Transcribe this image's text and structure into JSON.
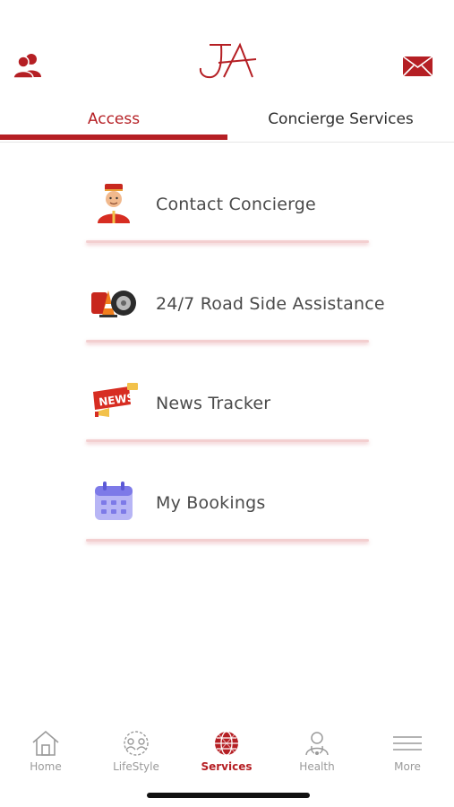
{
  "header": {
    "logo_text": "JA",
    "profile_icon": "profile-icon",
    "mail_icon": "mail-icon"
  },
  "tabs": [
    {
      "label": "Access",
      "active": true
    },
    {
      "label": "Concierge Services",
      "active": false
    }
  ],
  "menu": {
    "items": [
      {
        "label": "Contact Concierge",
        "icon": "concierge-icon"
      },
      {
        "label": "24/7 Road Side Assistance",
        "icon": "roadside-icon"
      },
      {
        "label": "News Tracker",
        "icon": "news-icon"
      },
      {
        "label": "My Bookings",
        "icon": "calendar-icon"
      }
    ]
  },
  "nav": {
    "items": [
      {
        "label": "Home",
        "icon": "home-icon",
        "active": false
      },
      {
        "label": "LifeStyle",
        "icon": "lifestyle-icon",
        "active": false
      },
      {
        "label": "Services",
        "icon": "globe-icon",
        "active": true
      },
      {
        "label": "Health",
        "icon": "health-icon",
        "active": false
      },
      {
        "label": "More",
        "icon": "menu-icon",
        "active": false
      }
    ]
  },
  "colors": {
    "accent": "#b51f24",
    "divider": "#f3cfd0",
    "inactive": "#9a9a9a"
  }
}
